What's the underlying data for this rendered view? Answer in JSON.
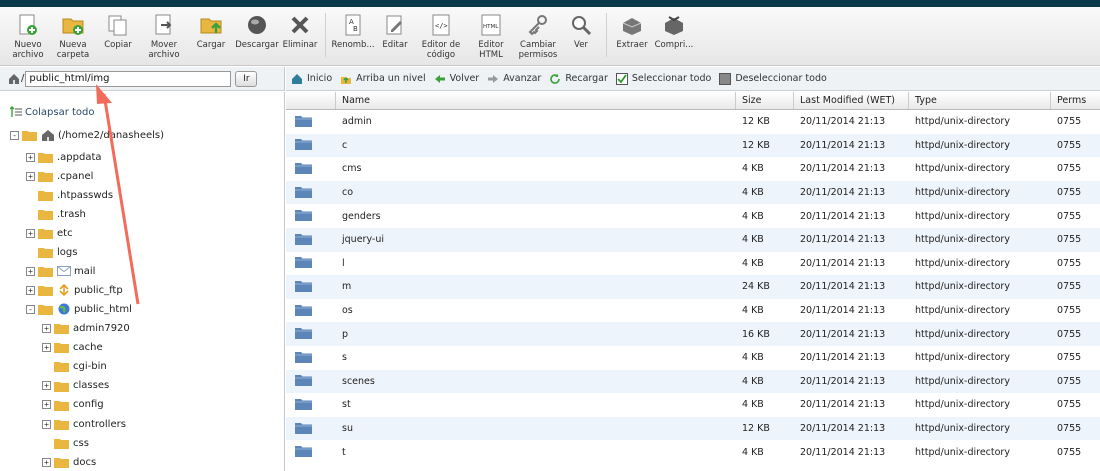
{
  "toolbar": {
    "items": [
      {
        "label": "Nuevo\narchivo",
        "icon": "new-file-icon"
      },
      {
        "label": "Nueva\ncarpeta",
        "icon": "new-folder-icon"
      },
      {
        "label": "Copiar",
        "icon": "copy-icon"
      },
      {
        "label": "Mover\narchivo",
        "icon": "move-file-icon"
      },
      {
        "label": "Cargar",
        "icon": "upload-icon"
      },
      {
        "label": "Descargar",
        "icon": "download-icon"
      },
      {
        "label": "Eliminar",
        "icon": "delete-icon"
      },
      {
        "label": "Renomb...",
        "icon": "rename-icon"
      },
      {
        "label": "Editar",
        "icon": "edit-icon"
      },
      {
        "label": "Editor de\ncódigo",
        "icon": "code-editor-icon"
      },
      {
        "label": "Editor\nHTML",
        "icon": "html-editor-icon"
      },
      {
        "label": "Cambiar\npermisos",
        "icon": "permissions-icon"
      },
      {
        "label": "Ver",
        "icon": "view-icon"
      },
      {
        "label": "Extraer",
        "icon": "extract-icon"
      },
      {
        "label": "Compri...",
        "icon": "compress-icon"
      }
    ]
  },
  "path": {
    "slash": "/",
    "value": "public_html/img",
    "go_label": "Ir"
  },
  "nav": {
    "home": "Inicio",
    "up": "Arriba un nivel",
    "back": "Volver",
    "forward": "Avanzar",
    "reload": "Recargar",
    "select_all": "Seleccionar todo",
    "deselect_all": "Deseleccionar todo"
  },
  "tree": {
    "collapse_label": "Colapsar todo",
    "root_label": "(/home2/danasheels)",
    "nodes": [
      {
        "label": ".appdata",
        "toggle": "+"
      },
      {
        "label": ".cpanel",
        "toggle": "+"
      },
      {
        "label": ".htpasswds",
        "toggle": ""
      },
      {
        "label": ".trash",
        "toggle": ""
      },
      {
        "label": "etc",
        "toggle": "+"
      },
      {
        "label": "logs",
        "toggle": ""
      },
      {
        "label": "mail",
        "toggle": "+"
      },
      {
        "label": "public_ftp",
        "toggle": "+"
      },
      {
        "label": "public_html",
        "toggle": "-"
      }
    ],
    "children": [
      {
        "label": "admin7920",
        "toggle": "+"
      },
      {
        "label": "cache",
        "toggle": "+"
      },
      {
        "label": "cgi-bin",
        "toggle": ""
      },
      {
        "label": "classes",
        "toggle": "+"
      },
      {
        "label": "config",
        "toggle": "+"
      },
      {
        "label": "controllers",
        "toggle": "+"
      },
      {
        "label": "css",
        "toggle": ""
      },
      {
        "label": "docs",
        "toggle": "+"
      }
    ]
  },
  "table": {
    "headers": [
      "Name",
      "Size",
      "Last Modified (WET)",
      "Type",
      "Perms"
    ],
    "rows": [
      {
        "name": "admin",
        "size": "12 KB",
        "modified": "20/11/2014 21:13",
        "type": "httpd/unix-directory",
        "perms": "0755"
      },
      {
        "name": "c",
        "size": "12 KB",
        "modified": "20/11/2014 21:13",
        "type": "httpd/unix-directory",
        "perms": "0755"
      },
      {
        "name": "cms",
        "size": "4 KB",
        "modified": "20/11/2014 21:13",
        "type": "httpd/unix-directory",
        "perms": "0755"
      },
      {
        "name": "co",
        "size": "4 KB",
        "modified": "20/11/2014 21:13",
        "type": "httpd/unix-directory",
        "perms": "0755"
      },
      {
        "name": "genders",
        "size": "4 KB",
        "modified": "20/11/2014 21:13",
        "type": "httpd/unix-directory",
        "perms": "0755"
      },
      {
        "name": "jquery-ui",
        "size": "4 KB",
        "modified": "20/11/2014 21:13",
        "type": "httpd/unix-directory",
        "perms": "0755"
      },
      {
        "name": "l",
        "size": "4 KB",
        "modified": "20/11/2014 21:13",
        "type": "httpd/unix-directory",
        "perms": "0755"
      },
      {
        "name": "m",
        "size": "24 KB",
        "modified": "20/11/2014 21:13",
        "type": "httpd/unix-directory",
        "perms": "0755"
      },
      {
        "name": "os",
        "size": "4 KB",
        "modified": "20/11/2014 21:13",
        "type": "httpd/unix-directory",
        "perms": "0755"
      },
      {
        "name": "p",
        "size": "16 KB",
        "modified": "20/11/2014 21:13",
        "type": "httpd/unix-directory",
        "perms": "0755"
      },
      {
        "name": "s",
        "size": "4 KB",
        "modified": "20/11/2014 21:13",
        "type": "httpd/unix-directory",
        "perms": "0755"
      },
      {
        "name": "scenes",
        "size": "4 KB",
        "modified": "20/11/2014 21:13",
        "type": "httpd/unix-directory",
        "perms": "0755"
      },
      {
        "name": "st",
        "size": "4 KB",
        "modified": "20/11/2014 21:13",
        "type": "httpd/unix-directory",
        "perms": "0755"
      },
      {
        "name": "su",
        "size": "12 KB",
        "modified": "20/11/2014 21:13",
        "type": "httpd/unix-directory",
        "perms": "0755"
      },
      {
        "name": "t",
        "size": "4 KB",
        "modified": "20/11/2014 21:13",
        "type": "httpd/unix-directory",
        "perms": "0755"
      }
    ]
  },
  "colors": {
    "top_bar": "#0b3a4a",
    "folder": "#e9b640",
    "row_folder": "#5b86b7",
    "annotation_arrow": "#f26b5b"
  }
}
